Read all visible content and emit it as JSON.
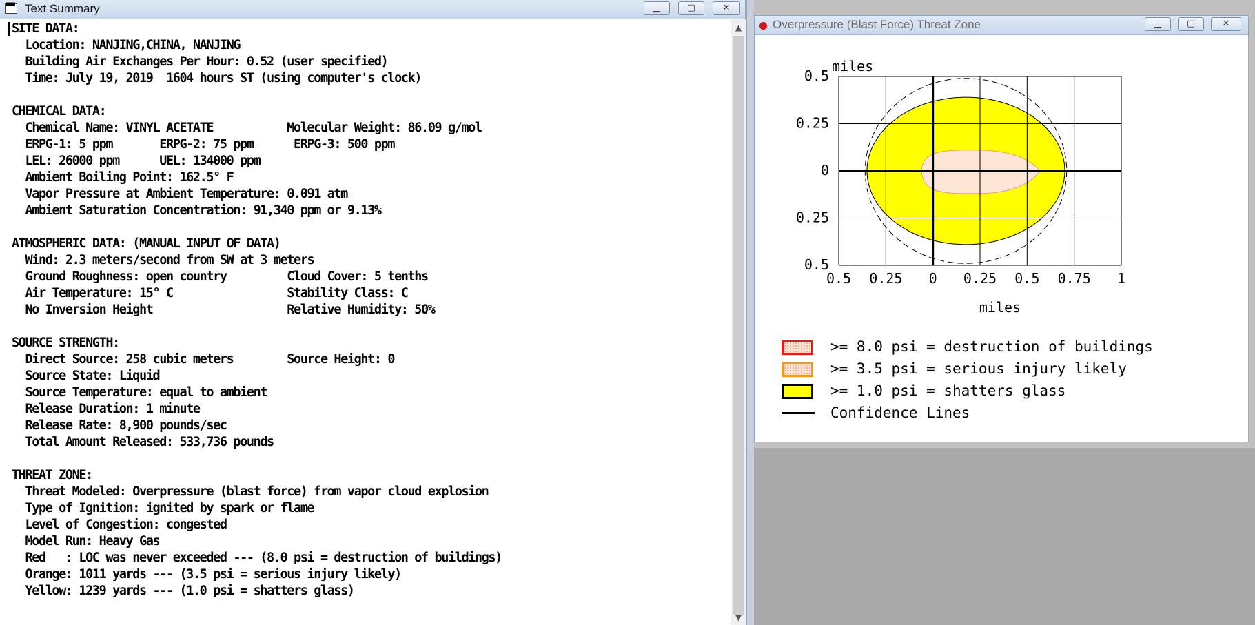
{
  "text_window": {
    "title": "Text Summary",
    "controls": {
      "minimize": "▁",
      "maximize": "▢",
      "close": "✕"
    },
    "report_lines": [
      "SITE DATA:",
      "  Location: NANJING,CHINA, NANJING",
      "  Building Air Exchanges Per Hour: 0.52 (user specified)",
      "  Time: July 19, 2019  1604 hours ST (using computer's clock)",
      "",
      "CHEMICAL DATA:",
      "  Chemical Name: VINYL ACETATE           Molecular Weight: 86.09 g/mol",
      "  ERPG-1: 5 ppm       ERPG-2: 75 ppm      ERPG-3: 500 ppm",
      "  LEL: 26000 ppm      UEL: 134000 ppm",
      "  Ambient Boiling Point: 162.5° F",
      "  Vapor Pressure at Ambient Temperature: 0.091 atm",
      "  Ambient Saturation Concentration: 91,340 ppm or 9.13%",
      "",
      "ATMOSPHERIC DATA: (MANUAL INPUT OF DATA)",
      "  Wind: 2.3 meters/second from SW at 3 meters",
      "  Ground Roughness: open country         Cloud Cover: 5 tenths",
      "  Air Temperature: 15° C                 Stability Class: C",
      "  No Inversion Height                    Relative Humidity: 50%",
      "",
      "SOURCE STRENGTH:",
      "  Direct Source: 258 cubic meters        Source Height: 0",
      "  Source State: Liquid",
      "  Source Temperature: equal to ambient",
      "  Release Duration: 1 minute",
      "  Release Rate: 8,900 pounds/sec",
      "  Total Amount Released: 533,736 pounds",
      "",
      "THREAT ZONE:",
      "  Threat Modeled: Overpressure (blast force) from vapor cloud explosion",
      "  Type of Ignition: ignited by spark or flame",
      "  Level of Congestion: congested",
      "  Model Run: Heavy Gas",
      "  Red   : LOC was never exceeded --- (8.0 psi = destruction of buildings)",
      "  Orange: 1011 yards --- (3.5 psi = serious injury likely)",
      "  Yellow: 1239 yards --- (1.0 psi = shatters glass)"
    ]
  },
  "plot_window": {
    "title": "Overpressure (Blast Force) Threat Zone",
    "controls": {
      "minimize": "▁",
      "maximize": "▢",
      "close": "✕"
    },
    "axis_unit_top": "miles",
    "axis_unit_bottom": "miles",
    "y_tick_labels": [
      "0.5",
      "0.25",
      "0",
      "0.25",
      "0.5"
    ],
    "x_tick_labels": [
      "0.5",
      "0.25",
      "0",
      "0.25",
      "0.5",
      "0.75",
      "1"
    ],
    "legend": [
      {
        "text": ">= 8.0 psi = destruction of buildings",
        "border": "#e31b1b",
        "fill": "#fde0cf"
      },
      {
        "text": ">= 3.5 psi = serious injury likely",
        "border": "#f29a1a",
        "fill": "#fde0cf"
      },
      {
        "text": ">= 1.0 psi = shatters glass",
        "border": "#000000",
        "fill": "#ffff00"
      },
      {
        "text": "Confidence Lines",
        "border": "#000000",
        "fill": ""
      }
    ],
    "colors": {
      "yellow_zone": "#ffff00",
      "orange_zone": "#fde6d6",
      "grid": "#000000"
    }
  },
  "chart_data": {
    "type": "area",
    "xlabel": "miles",
    "ylabel": "miles",
    "xlim": [
      -0.5,
      1
    ],
    "ylim": [
      -0.5,
      0.5
    ],
    "x_ticks": [
      -0.5,
      -0.25,
      0,
      0.25,
      0.5,
      0.75,
      1
    ],
    "y_ticks": [
      -0.5,
      -0.25,
      0,
      0.25,
      0.5
    ],
    "zones": [
      {
        "name": ">= 1.0 psi = shatters glass",
        "x_extent": [
          -0.35,
          0.7
        ],
        "y_extent": [
          -0.39,
          0.39
        ]
      },
      {
        "name": ">= 3.5 psi = serious injury likely",
        "x_extent": [
          -0.06,
          0.57
        ],
        "y_extent": [
          -0.12,
          0.11
        ]
      }
    ],
    "confidence_lines": {
      "x_extent": [
        -0.36,
        0.71
      ],
      "y_extent": [
        -0.49,
        0.49
      ]
    }
  }
}
